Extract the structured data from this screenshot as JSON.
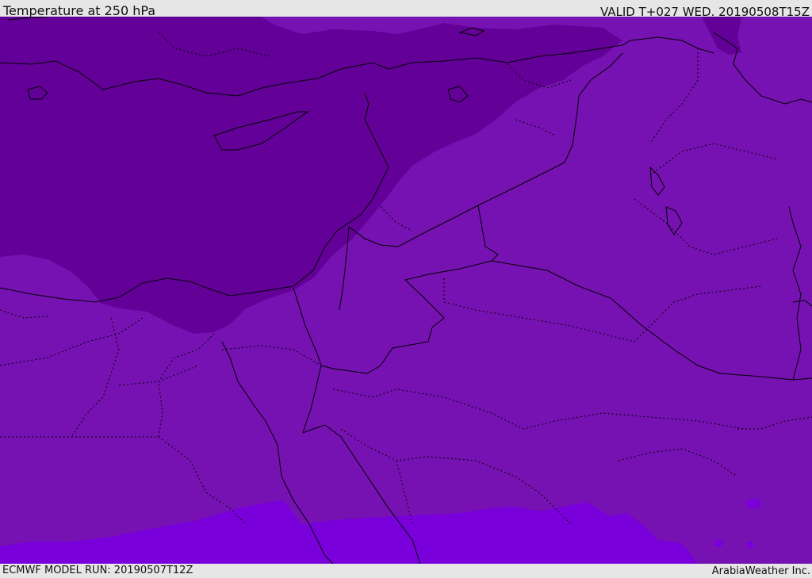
{
  "header": {
    "title": "Temperature at 250 hPa",
    "valid_time": "VALID T+027 WED. 20190508T15Z"
  },
  "footer": {
    "model_run": "ECMWF MODEL RUN: 20190507T12Z",
    "credit": "ArabiaWeather Inc."
  },
  "map": {
    "type": "filled temperature contour map",
    "region": "Eastern Mediterranean, Egypt, Levant, Arabian Peninsula, Iraq",
    "colors": {
      "coldest_band": "#630098",
      "middle_band": "#7612b2",
      "warmest_band": "#7a00db",
      "coastline": "#000000",
      "border_dotted": "#000000"
    }
  }
}
